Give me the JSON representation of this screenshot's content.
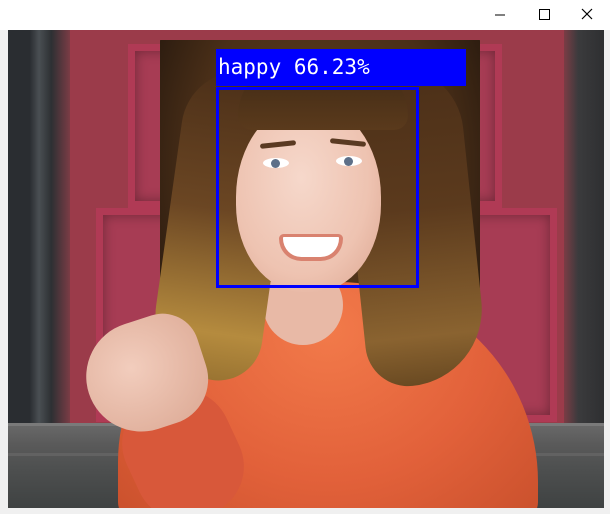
{
  "window": {
    "title": "",
    "controls": {
      "minimize_icon": "minimize-icon",
      "maximize_icon": "maximize-icon",
      "close_icon": "close-icon"
    }
  },
  "detection": {
    "label": "happy 66.23%",
    "box_color": "#0000ff",
    "label_text_color": "#ffffff"
  }
}
